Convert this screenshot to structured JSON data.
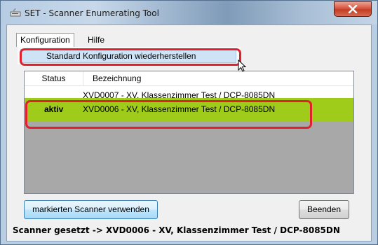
{
  "window": {
    "title": "SET - Scanner Enumerating Tool"
  },
  "menu": {
    "items": [
      {
        "label": "Konfiguration"
      },
      {
        "label": "Hilfe"
      }
    ],
    "dropdown": {
      "items": [
        {
          "label": "Standard Konfiguration wiederherstellen"
        }
      ]
    }
  },
  "list": {
    "columns": [
      {
        "label": "Status"
      },
      {
        "label": "Bezeichnung"
      }
    ],
    "rows": [
      {
        "status": "",
        "bezeichnung": "XVD0007 - XV, Klassenzimmer Test / DCP-8085DN",
        "selected": false
      },
      {
        "status": "aktiv",
        "bezeichnung": "XVD0006 - XV, Klassenzimmer Test / DCP-8085DN",
        "selected": true
      }
    ]
  },
  "buttons": {
    "use_label": "markierten Scanner verwenden",
    "end_label": "Beenden"
  },
  "status": {
    "text": "Scanner gesetzt -> XVD0006 - XV, Klassenzimmer Test / DCP-8085DN"
  },
  "colors": {
    "active_row": "#9fcb1b",
    "callout": "#e0202a",
    "close_button": "#c94a33"
  }
}
